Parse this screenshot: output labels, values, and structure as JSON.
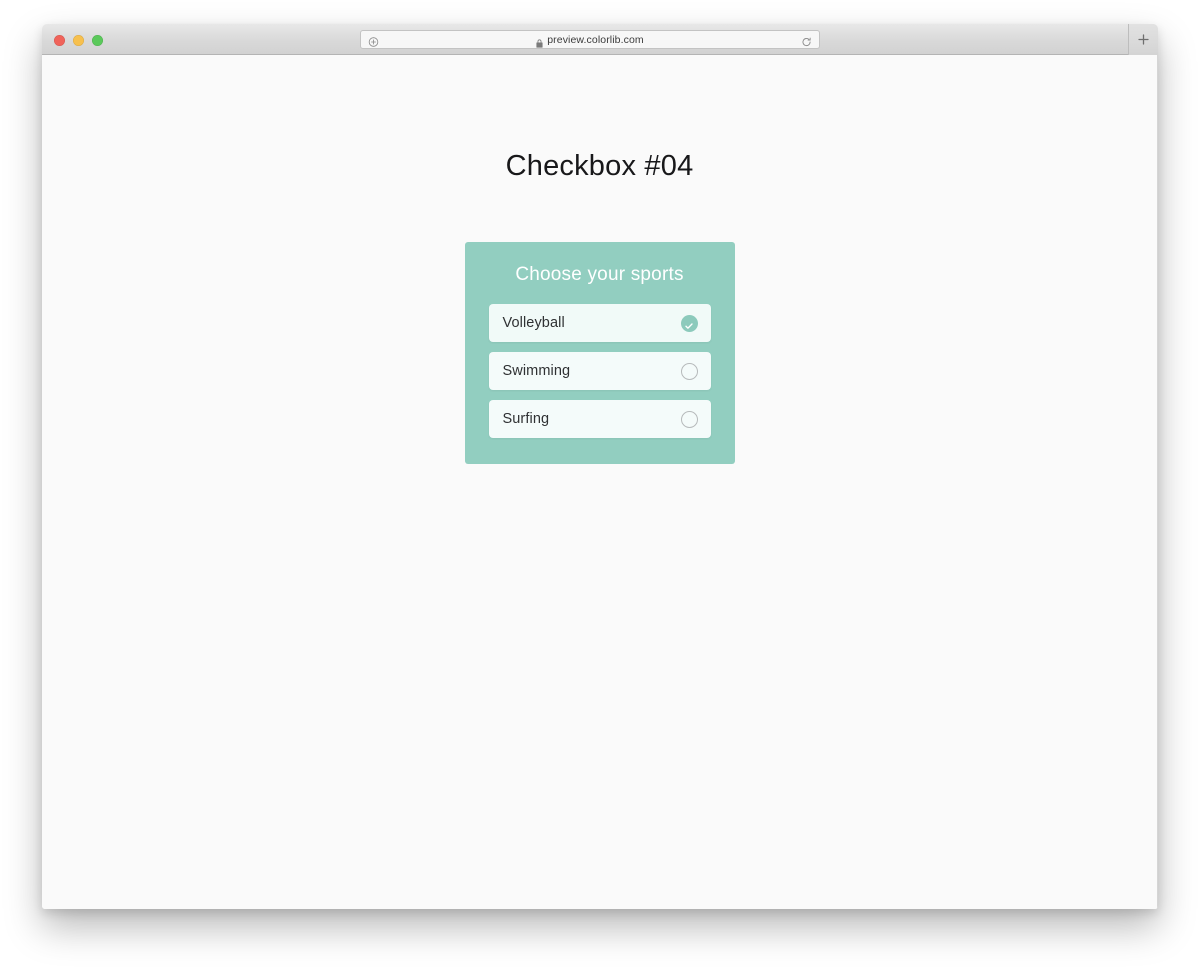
{
  "browser": {
    "traffic_lights": [
      {
        "name": "close",
        "color": "#f0635a"
      },
      {
        "name": "minimize",
        "color": "#f7c04e"
      },
      {
        "name": "maximize",
        "color": "#5bc95b"
      }
    ],
    "address_bar": {
      "url": "preview.colorlib.com",
      "lock_icon": "lock-icon",
      "left_icon": "page-info-icon",
      "reload_icon": "reload-icon"
    },
    "new_tab_icon": "plus-icon"
  },
  "page": {
    "title": "Checkbox #04",
    "background_color": "#fafafa"
  },
  "card": {
    "heading": "Choose your sports",
    "background_color": "#92cec0",
    "row_background_color": "#f4fbfa",
    "accent_color": "#8ccabc",
    "options": [
      {
        "label": "Volleyball",
        "checked": true,
        "indicator_icon": "check-circle-filled-icon"
      },
      {
        "label": "Swimming",
        "checked": false,
        "indicator_icon": "circle-outline-icon"
      },
      {
        "label": "Surfing",
        "checked": false,
        "indicator_icon": "circle-outline-icon"
      }
    ]
  }
}
